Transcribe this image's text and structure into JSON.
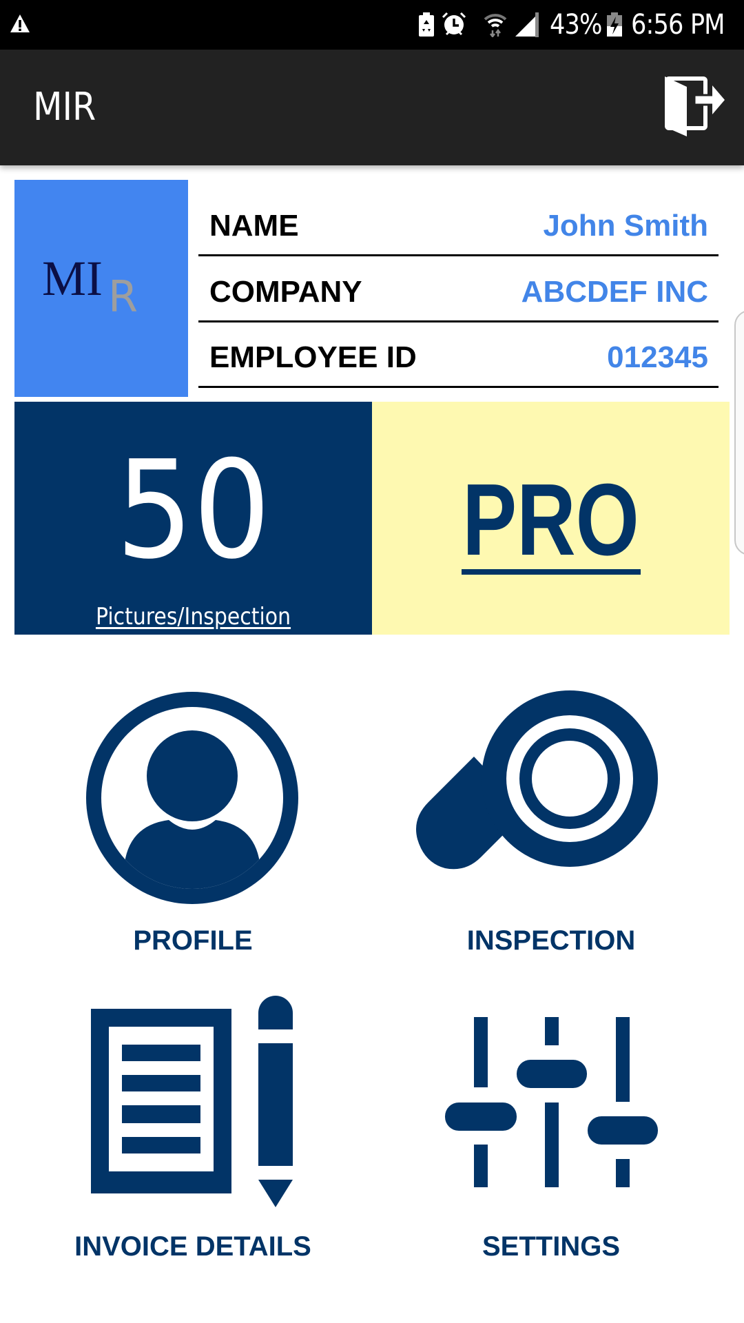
{
  "status_bar": {
    "warning_icon": "warning-triangle-icon",
    "icons": [
      "battery-saver-icon",
      "alarm-icon",
      "wifi-icon",
      "signal-icon"
    ],
    "battery_percent": "43%",
    "battery_icon": "battery-charging-icon",
    "time": "6:56 PM"
  },
  "app_bar": {
    "title": "MIR",
    "logout_icon": "logout-door-icon"
  },
  "profile": {
    "logo_letters": [
      "M",
      "I",
      "R"
    ],
    "rows": [
      {
        "label": "NAME",
        "value": "John Smith"
      },
      {
        "label": "COMPANY",
        "value": "ABCDEF INC"
      },
      {
        "label": "EMPLOYEE ID",
        "value": "012345"
      }
    ]
  },
  "stats": {
    "pictures_count": "50",
    "pictures_caption": "Pictures/Inspection",
    "plan": "PRO"
  },
  "menu": [
    {
      "label": "PROFILE",
      "icon": "profile-user-icon"
    },
    {
      "label": "INSPECTION",
      "icon": "magnifier-icon"
    },
    {
      "label": "INVOICE DETAILS",
      "icon": "invoice-document-pencil-icon"
    },
    {
      "label": "SETTINGS",
      "icon": "settings-sliders-icon"
    }
  ],
  "colors": {
    "navy": "#023467",
    "blue_accent": "#4285E8",
    "logo_bg": "#4285F0",
    "plan_bg": "#FEF9B1",
    "app_bar": "#222222"
  }
}
